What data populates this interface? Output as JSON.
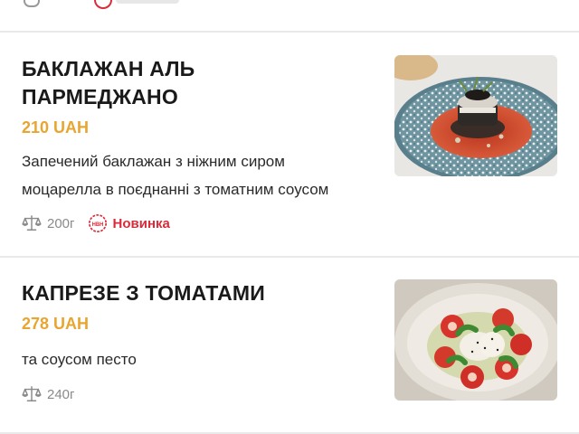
{
  "menu_items": [
    {
      "title_line1": "БАКЛАЖАН АЛЬ",
      "title_line2": "ПАРМЕДЖАНО",
      "price": "210 UAH",
      "description_line1": "Запечений баклажан з ніжним сиром",
      "description_line2": "моцарелла в поєднанні з томатним соусом",
      "weight": "200г",
      "badge": "Новинка",
      "badge_icon_text": "НВН",
      "icons": {
        "weight": "scale-icon",
        "badge": "new-badge-icon"
      },
      "photo": "eggplant-parmigiana-photo"
    },
    {
      "title_line1": "КАПРЕЗЕ З ТОМАТАМИ",
      "price": "278 UAH",
      "description_line1": "та соусом песто",
      "weight": "240г",
      "icons": {
        "weight": "scale-icon"
      },
      "photo": "caprese-photo"
    }
  ],
  "colors": {
    "price": "#e8a52f",
    "badge": "#d92b3a",
    "title": "#1a1a1a",
    "muted": "#8a8a8a",
    "divider": "#e9e9e9"
  }
}
